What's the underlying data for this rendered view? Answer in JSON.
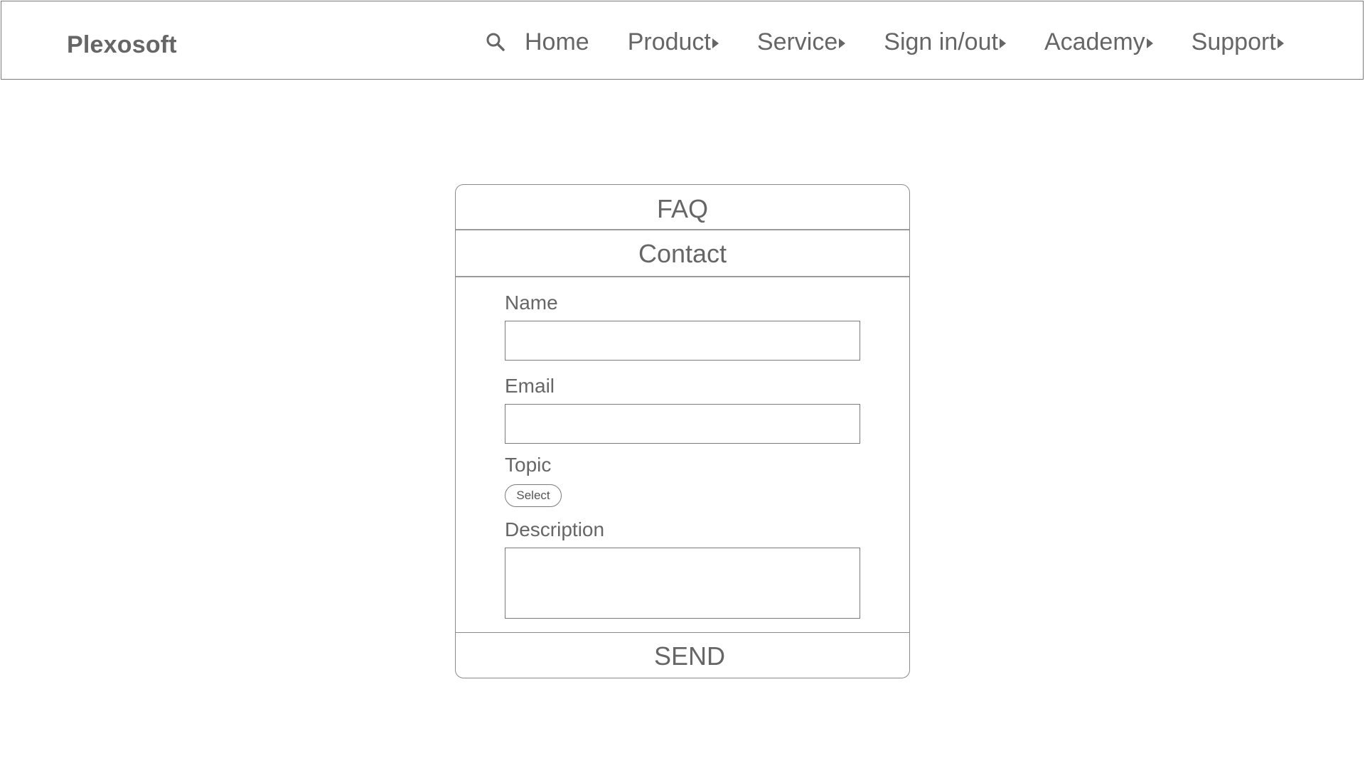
{
  "header": {
    "brand": "Plexosoft",
    "search_icon": "search-icon",
    "nav": [
      {
        "label": "Home",
        "has_arrow": false
      },
      {
        "label": "Product",
        "has_arrow": true
      },
      {
        "label": "Service",
        "has_arrow": true
      },
      {
        "label": "Sign in/out",
        "has_arrow": true
      },
      {
        "label": "Academy",
        "has_arrow": true
      },
      {
        "label": "Support",
        "has_arrow": true
      }
    ]
  },
  "panel": {
    "faq_label": "FAQ",
    "contact_label": "Contact",
    "form": {
      "name_label": "Name",
      "name_value": "",
      "email_label": "Email",
      "email_value": "",
      "topic_label": "Topic",
      "topic_select": "Select",
      "description_label": "Description",
      "description_value": ""
    },
    "send_label": "SEND"
  },
  "colors": {
    "text": "#666666",
    "border": "#7a7a7a",
    "background": "#ffffff"
  }
}
